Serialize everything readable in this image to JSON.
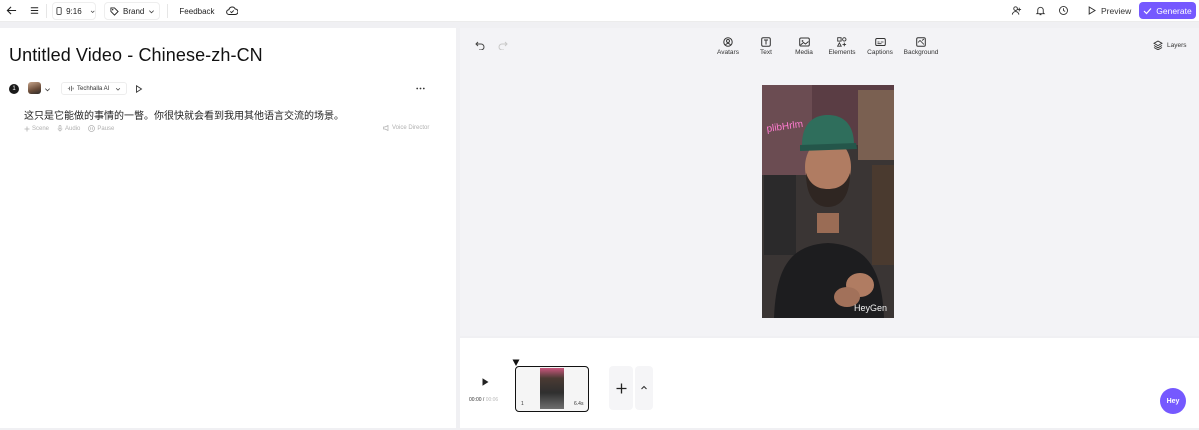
{
  "topbar": {
    "aspect_ratio": "9:16",
    "brand_label": "Brand",
    "feedback_label": "Feedback",
    "preview_label": "Preview",
    "generate_label": "Generate"
  },
  "script": {
    "title": "Untitled Video - Chinese-zh-CN",
    "scene_number": "1",
    "voice_name": "Techhalla AI",
    "text": "这只是它能做的事情的一瞥。你很快就会看到我用其他语言交流的场景。",
    "tools": [
      "Scene",
      "Audio",
      "Pause"
    ],
    "voice_director_label": "Voice Director"
  },
  "canvas": {
    "tools": [
      "Avatars",
      "Text",
      "Media",
      "Elements",
      "Captions",
      "Background"
    ],
    "layers_label": "Layers",
    "neon_sign": "plibHrlm",
    "watermark": "HeyGen"
  },
  "timeline": {
    "current_time": "00:00",
    "total_time": "00:06",
    "clip_number": "1",
    "clip_duration": "6.4s"
  },
  "assistant_label": "Hey",
  "colors": {
    "accent": "#7559ff"
  }
}
